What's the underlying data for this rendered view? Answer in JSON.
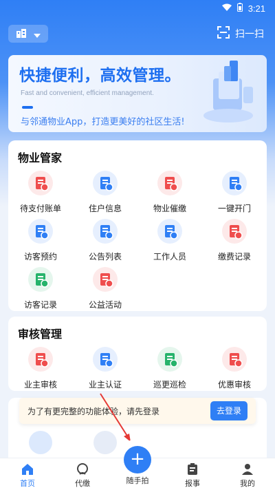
{
  "status_bar": {
    "time": "3:21"
  },
  "header": {
    "scan_label": "扫一扫"
  },
  "banner": {
    "title": "快捷便利，高效管理。",
    "subtitle": "Fast and convenient, efficient management.",
    "description": "与邻通物业App，打造更美好的社区生活!"
  },
  "property": {
    "title": "物业管家",
    "items": [
      {
        "label": "待支付账单",
        "icon": "bill-icon",
        "color": "#ef4d4d"
      },
      {
        "label": "住户信息",
        "icon": "house-icon",
        "color": "#2f7ff5"
      },
      {
        "label": "物业催缴",
        "icon": "megaphone-icon",
        "color": "#ef4d4d"
      },
      {
        "label": "一键开门",
        "icon": "door-icon",
        "color": "#2f7ff5"
      },
      {
        "label": "访客预约",
        "icon": "visitor-booking-icon",
        "color": "#2f7ff5"
      },
      {
        "label": "公告列表",
        "icon": "notice-icon",
        "color": "#2f7ff5"
      },
      {
        "label": "工作人员",
        "icon": "staff-icon",
        "color": "#2f7ff5"
      },
      {
        "label": "缴费记录",
        "icon": "payment-record-icon",
        "color": "#ef4d4d"
      },
      {
        "label": "访客记录",
        "icon": "visitor-record-icon",
        "color": "#26b36b"
      },
      {
        "label": "公益活动",
        "icon": "balloon-icon",
        "color": "#ef4d4d"
      }
    ]
  },
  "audit": {
    "title": "审核管理",
    "items": [
      {
        "label": "业主审核",
        "icon": "owner-review-icon",
        "color": "#ef4d4d"
      },
      {
        "label": "业主认证",
        "icon": "owner-verify-icon",
        "color": "#2f7ff5"
      },
      {
        "label": "巡更巡检",
        "icon": "patrol-icon",
        "color": "#26b36b"
      },
      {
        "label": "优惠审核",
        "icon": "discount-review-icon",
        "color": "#ef4d4d"
      }
    ]
  },
  "login_prompt": {
    "text": "为了有更完整的功能体验，请先登录",
    "button": "去登录"
  },
  "bottom_nav": {
    "items": [
      {
        "label": "首页",
        "icon": "home-icon"
      },
      {
        "label": "代缴",
        "icon": "pay-icon"
      },
      {
        "label": "随手拍",
        "icon": "plus-icon"
      },
      {
        "label": "报事",
        "icon": "report-icon"
      },
      {
        "label": "我的",
        "icon": "profile-icon"
      }
    ]
  },
  "colors": {
    "primary": "#2f7ff5",
    "red": "#ef4d4d",
    "green": "#26b36b"
  }
}
